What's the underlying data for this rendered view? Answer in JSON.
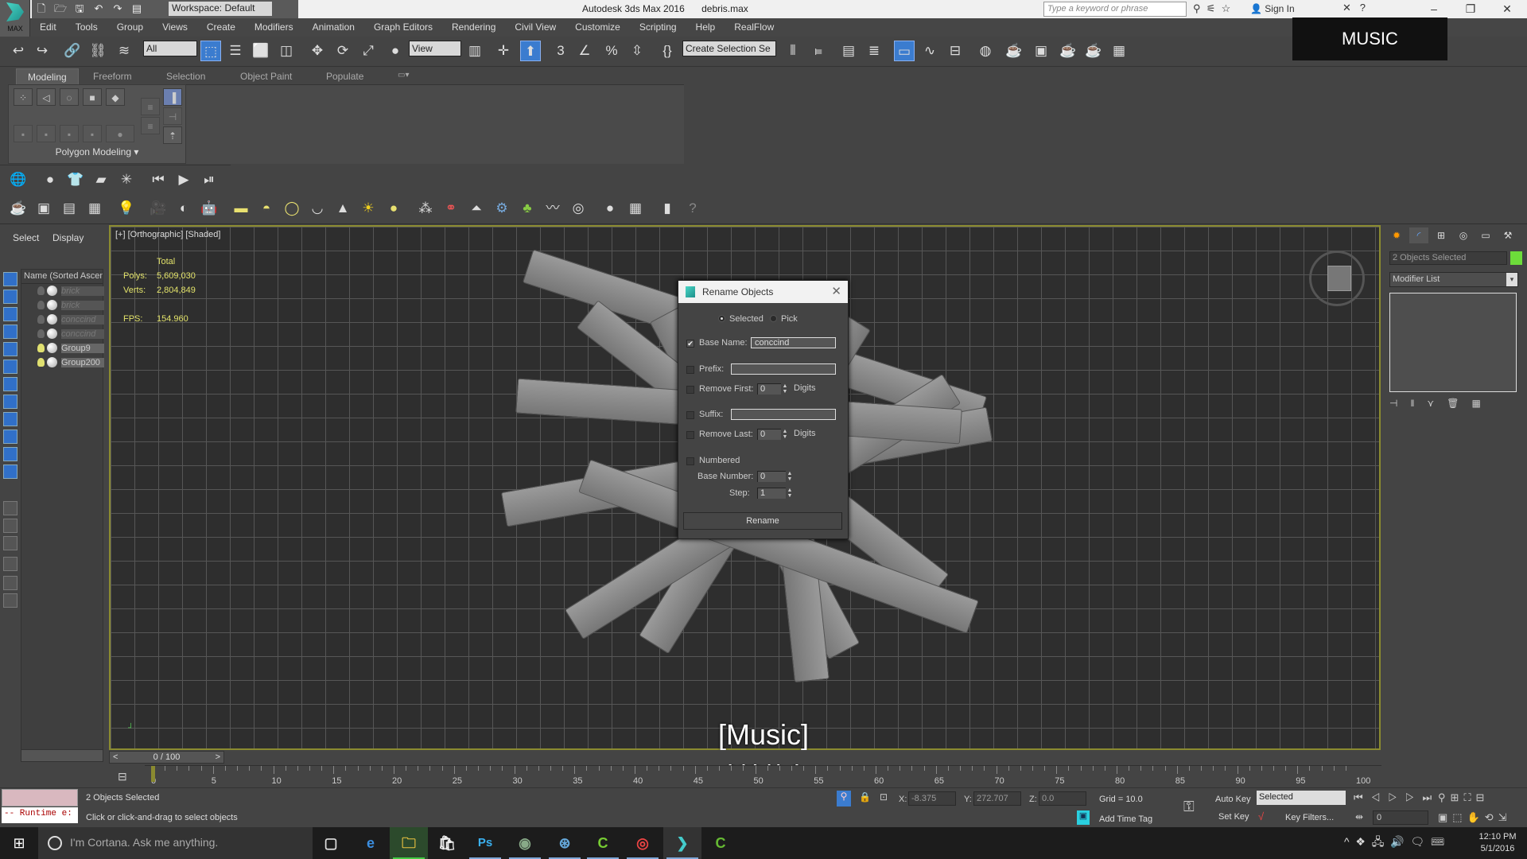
{
  "window": {
    "app_title": "Autodesk 3ds Max 2016",
    "file_name": "debris.max",
    "logo_label": "MAX",
    "workspace": "Workspace: Default",
    "search_placeholder": "Type a keyword or phrase",
    "sign_in": "Sign In",
    "controls": {
      "minimize": "–",
      "maximize": "❐",
      "close": "✕"
    }
  },
  "menu": [
    "Edit",
    "Tools",
    "Group",
    "Views",
    "Create",
    "Modifiers",
    "Animation",
    "Graph Editors",
    "Rendering",
    "Civil View",
    "Customize",
    "Scripting",
    "Help",
    "RealFlow"
  ],
  "toolbar": {
    "selection_filter": "All",
    "reference_coord": "View",
    "named_selection_placeholder": "Create Selection Se"
  },
  "overlay": {
    "music_banner": "MUSIC",
    "subtitle_line1": "[Music]",
    "subtitle_line2": "[音乐]"
  },
  "ribbon": {
    "tabs": [
      "Modeling",
      "Freeform",
      "Selection",
      "Object Paint",
      "Populate"
    ],
    "active_tab": "Modeling",
    "panel_label": "Polygon Modeling ▾"
  },
  "scene_explorer": {
    "tabs": [
      "Select",
      "Display"
    ],
    "column_header": "Name (Sorted Ascending)",
    "rows": [
      {
        "name": "brick",
        "visible": false,
        "selected": false
      },
      {
        "name": "brick",
        "visible": false,
        "selected": false
      },
      {
        "name": "conccind",
        "visible": false,
        "selected": false
      },
      {
        "name": "conccind",
        "visible": false,
        "selected": false
      },
      {
        "name": "Group9",
        "visible": true,
        "selected": true
      },
      {
        "name": "Group200",
        "visible": true,
        "selected": true
      }
    ]
  },
  "viewport": {
    "label": "[+] [Orthographic] [Shaded]",
    "stats": {
      "header": "Total",
      "polys_label": "Polys:",
      "polys": "5,609,030",
      "verts_label": "Verts:",
      "verts": "2,804,849",
      "fps_label": "FPS:",
      "fps": "154.960"
    }
  },
  "rename_dialog": {
    "title": "Rename Objects",
    "radio_selected": "Selected",
    "radio_pick": "Pick",
    "base_name_label": "Base Name:",
    "base_name_value": "conccind",
    "base_name_checked": true,
    "prefix_label": "Prefix:",
    "prefix_value": "",
    "remove_first_label": "Remove First:",
    "remove_first_value": "0",
    "digits_label": "Digits",
    "suffix_label": "Suffix:",
    "suffix_value": "",
    "remove_last_label": "Remove Last:",
    "remove_last_value": "0",
    "numbered_label": "Numbered",
    "base_number_label": "Base Number:",
    "base_number_value": "0",
    "step_label": "Step:",
    "step_value": "1",
    "rename_button": "Rename"
  },
  "command_panel": {
    "selection_name": "2 Objects Selected",
    "object_color": "#6ddc3a",
    "modifier_list": "Modifier List"
  },
  "timeline": {
    "slider": "0 / 100",
    "prev": "<",
    "next": ">",
    "ticks": [
      "0",
      "5",
      "10",
      "15",
      "20",
      "25",
      "30",
      "35",
      "40",
      "45",
      "50",
      "55",
      "60",
      "65",
      "70",
      "75",
      "80",
      "85",
      "90",
      "95",
      "100"
    ]
  },
  "status": {
    "maxscript_output": "-- Runtime e:",
    "selection": "2 Objects Selected",
    "prompt": "Click or click-and-drag to select objects",
    "x_label": "X:",
    "x_value": "-8.375",
    "y_label": "Y:",
    "y_value": "272.707",
    "z_label": "Z:",
    "z_value": "0.0",
    "grid": "Grid = 10.0",
    "add_time_tag": "Add Time Tag",
    "auto_key": "Auto Key",
    "set_key": "Set Key",
    "key_mode": "Selected",
    "key_filters": "Key Filters...",
    "current_frame": "0"
  },
  "taskbar": {
    "cortana": "I'm Cortana. Ask me anything.",
    "time": "12:10 PM",
    "date": "5/1/2016"
  }
}
